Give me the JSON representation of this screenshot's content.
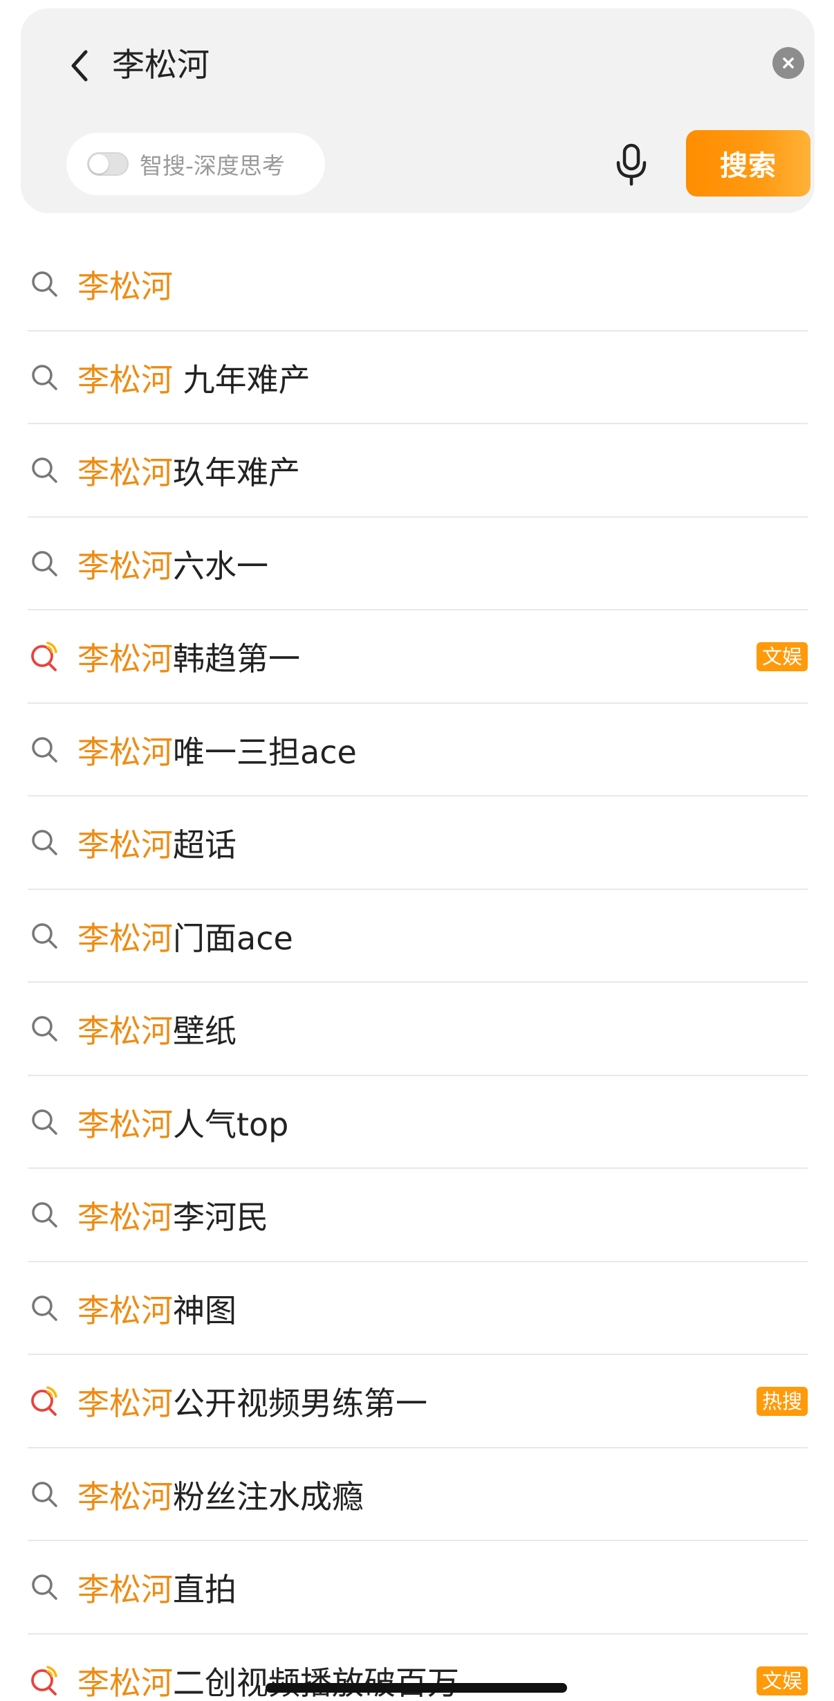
{
  "search": {
    "query": "李松河",
    "deep_think_label": "智搜-深度思考",
    "deep_think_enabled": false,
    "search_button_label": "搜索"
  },
  "suggestions": [
    {
      "highlight": "李松河",
      "rest": "",
      "hot": false,
      "badge": ""
    },
    {
      "highlight": "李松河",
      "rest": " 九年难产",
      "hot": false,
      "badge": ""
    },
    {
      "highlight": "李松河",
      "rest": "玖年难产",
      "hot": false,
      "badge": ""
    },
    {
      "highlight": "李松河",
      "rest": "六水一",
      "hot": false,
      "badge": ""
    },
    {
      "highlight": "李松河",
      "rest": "韩趋第一",
      "hot": true,
      "badge": "文娱"
    },
    {
      "highlight": "李松河",
      "rest": "唯一三担ace",
      "hot": false,
      "badge": ""
    },
    {
      "highlight": "李松河",
      "rest": "超话",
      "hot": false,
      "badge": ""
    },
    {
      "highlight": "李松河",
      "rest": "门面ace",
      "hot": false,
      "badge": ""
    },
    {
      "highlight": "李松河",
      "rest": "壁纸",
      "hot": false,
      "badge": ""
    },
    {
      "highlight": "李松河",
      "rest": "人气top",
      "hot": false,
      "badge": ""
    },
    {
      "highlight": "李松河",
      "rest": "李河民",
      "hot": false,
      "badge": ""
    },
    {
      "highlight": "李松河",
      "rest": "神图",
      "hot": false,
      "badge": ""
    },
    {
      "highlight": "李松河",
      "rest": "公开视频男练第一",
      "hot": true,
      "badge": "热搜"
    },
    {
      "highlight": "李松河",
      "rest": "粉丝注水成瘾",
      "hot": false,
      "badge": ""
    },
    {
      "highlight": "李松河",
      "rest": "直拍",
      "hot": false,
      "badge": ""
    },
    {
      "highlight": "李松河",
      "rest": "二创视频播放破百万",
      "hot": true,
      "badge": "文娱"
    }
  ],
  "colors": {
    "accent": "#ff9a0a",
    "highlight_text": "#ee8c14",
    "hot_icon": "#e8433d"
  },
  "icons": {
    "back": "chevron-left-icon",
    "clear": "clear-x-icon",
    "mic": "microphone-icon",
    "search": "search-icon",
    "hot_search": "hot-search-icon"
  }
}
